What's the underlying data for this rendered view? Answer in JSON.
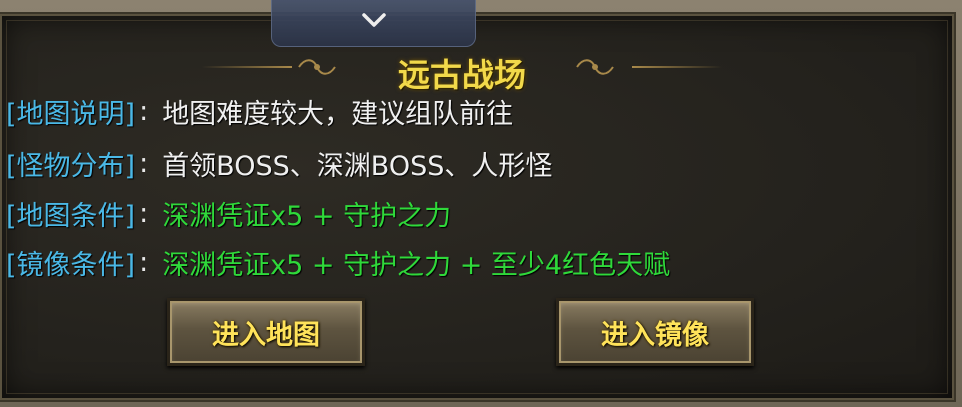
{
  "dialog": {
    "title": "远古战场",
    "collapse_icon": "chevron-down-icon"
  },
  "info": [
    {
      "label": "[地图说明]",
      "colon": ":",
      "value": "地图难度较大，建议组队前往",
      "color": "white"
    },
    {
      "label": "[怪物分布]",
      "colon": ":",
      "value": "首领BOSS、深渊BOSS、人形怪",
      "color": "white"
    },
    {
      "label": "[地图条件]",
      "colon": ":",
      "value": "深渊凭证x5 + 守护之力",
      "color": "green"
    },
    {
      "label": "[镜像条件]",
      "colon": ":",
      "value": "深渊凭证x5 + 守护之力 +  至少4红色天赋",
      "color": "green"
    }
  ],
  "buttons": {
    "enter_map": "进入地图",
    "enter_mirror": "进入镜像"
  },
  "colors": {
    "title": "#f2d94a",
    "label": "#4ab8e6",
    "value_white": "#f0f0f0",
    "value_green": "#2fd93a",
    "button_text": "#ffe35a"
  }
}
